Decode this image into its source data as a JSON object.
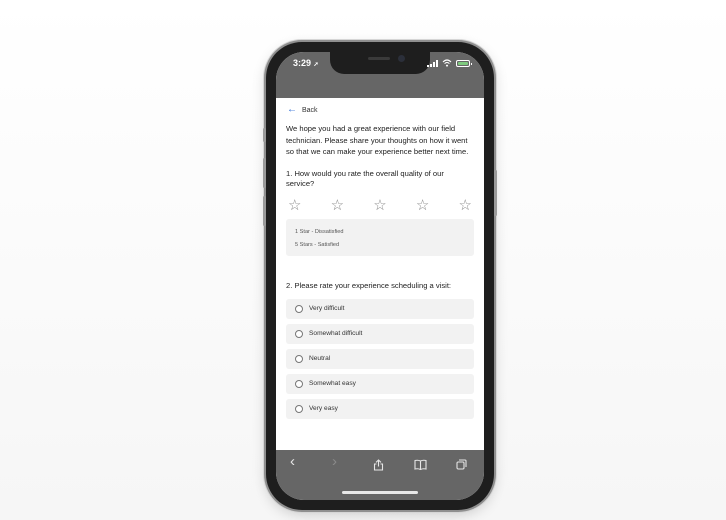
{
  "status_bar": {
    "time": "3:29",
    "location_glyph": "➚",
    "icons": [
      "signal-icon",
      "wifi-icon",
      "battery-icon"
    ]
  },
  "nav": {
    "back_label": "Back",
    "back_glyph": "←"
  },
  "intro": "We hope you had a great experience with our field technician. Please share your thoughts on how it went so that we can make your experience better next time.",
  "question1": {
    "text": "1. How would you rate the overall quality of our service?",
    "star_glyph": "☆",
    "stars": [
      1,
      2,
      3,
      4,
      5
    ],
    "legend": [
      "1 Star - Dissatisfied",
      "5 Stars - Satisfied"
    ]
  },
  "question2": {
    "text": "2. Please rate your experience scheduling a visit:",
    "options": [
      "Very difficult",
      "Somewhat difficult",
      "Neutral",
      "Somewhat easy",
      "Very easy"
    ]
  },
  "toolbar": {
    "back_glyph": "‹",
    "forward_glyph": "›",
    "share_glyph": "⇧",
    "bookmarks_glyph": "▯▯",
    "tabs_glyph": "❐"
  },
  "colors": {
    "accent": "#2b6cd6",
    "chrome": "#666666",
    "option_bg": "#f2f2f2"
  }
}
